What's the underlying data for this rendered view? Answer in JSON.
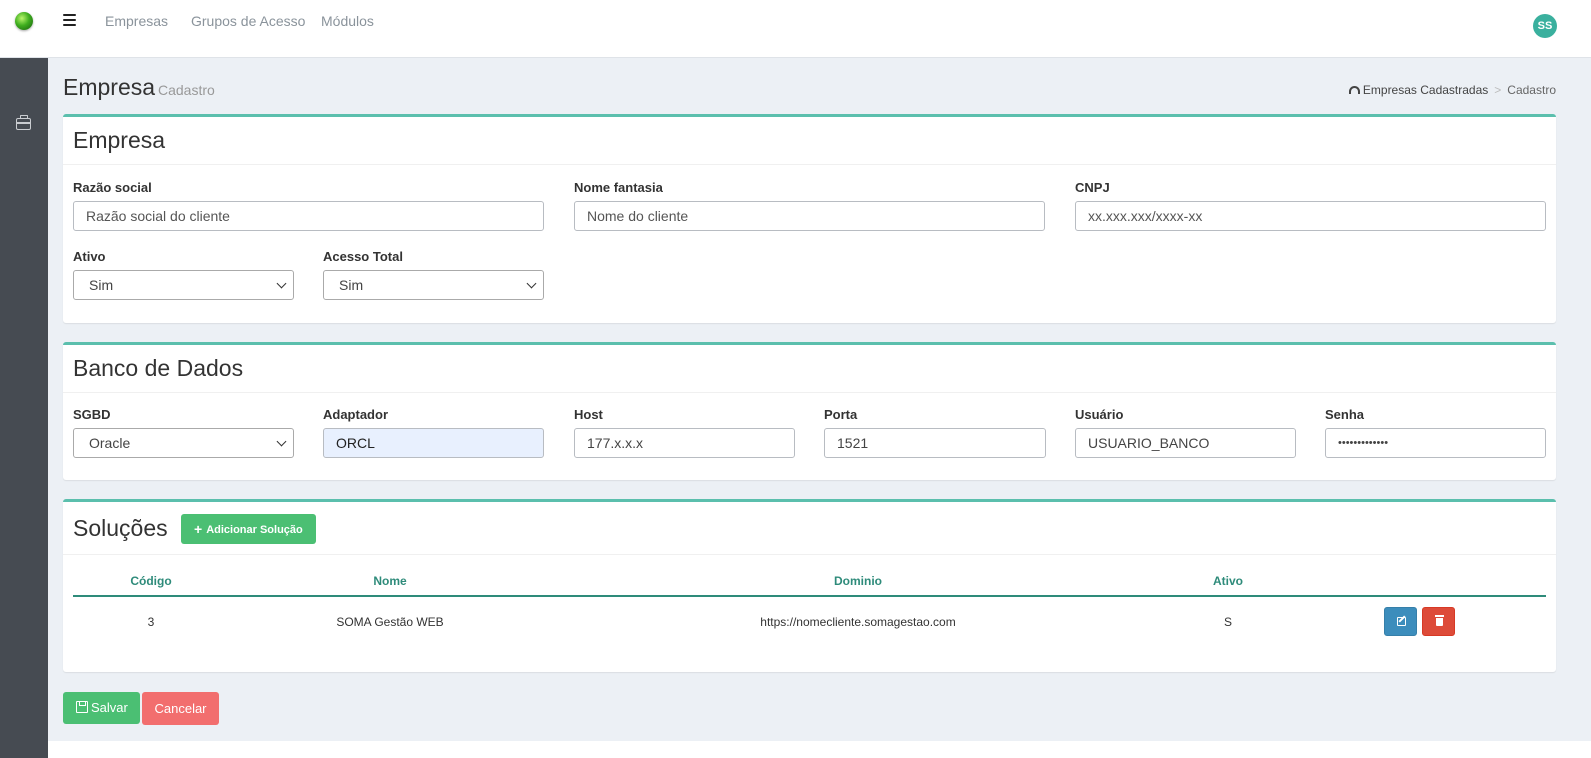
{
  "nav": {
    "links": [
      "Empresas",
      "Grupos de Acesso",
      "Módulos"
    ],
    "avatar_initials": "SS"
  },
  "page": {
    "title": "Empresa",
    "subtitle": "Cadastro"
  },
  "breadcrumb": {
    "home": "Empresas Cadastradas",
    "separator": ">",
    "current": "Cadastro"
  },
  "empresa": {
    "title": "Empresa",
    "razao_social": {
      "label": "Razão social",
      "placeholder": "Razão social do cliente"
    },
    "nome_fantasia": {
      "label": "Nome fantasia",
      "placeholder": "Nome do cliente"
    },
    "cnpj": {
      "label": "CNPJ",
      "placeholder": "xx.xxx.xxx/xxxx-xx"
    },
    "ativo": {
      "label": "Ativo",
      "value": "Sim"
    },
    "acesso_total": {
      "label": "Acesso Total",
      "value": "Sim"
    }
  },
  "banco": {
    "title": "Banco de Dados",
    "sgbd": {
      "label": "SGBD",
      "value": "Oracle"
    },
    "adaptador": {
      "label": "Adaptador",
      "value": "ORCL"
    },
    "host": {
      "label": "Host",
      "value": "177.x.x.x"
    },
    "porta": {
      "label": "Porta",
      "value": "1521"
    },
    "usuario": {
      "label": "Usuário",
      "value": "USUARIO_BANCO"
    },
    "senha": {
      "label": "Senha",
      "value": "•••••••••••••"
    }
  },
  "solucoes": {
    "title": "Soluções",
    "add_button": "Adicionar Solução",
    "columns": [
      "Código",
      "Nome",
      "Dominio",
      "Ativo"
    ],
    "rows": [
      {
        "codigo": "3",
        "nome": "SOMA Gestão WEB",
        "dominio": "https://nomecliente.somagestao.com",
        "ativo": "S"
      }
    ]
  },
  "actions": {
    "save": "Salvar",
    "cancel": "Cancelar"
  },
  "colors": {
    "accent": "#5bbfad",
    "success": "#4bbf73",
    "danger_light": "#f26e6e",
    "edit": "#3c8dbc",
    "delete": "#dd4b39",
    "sidebar": "#464b52"
  }
}
